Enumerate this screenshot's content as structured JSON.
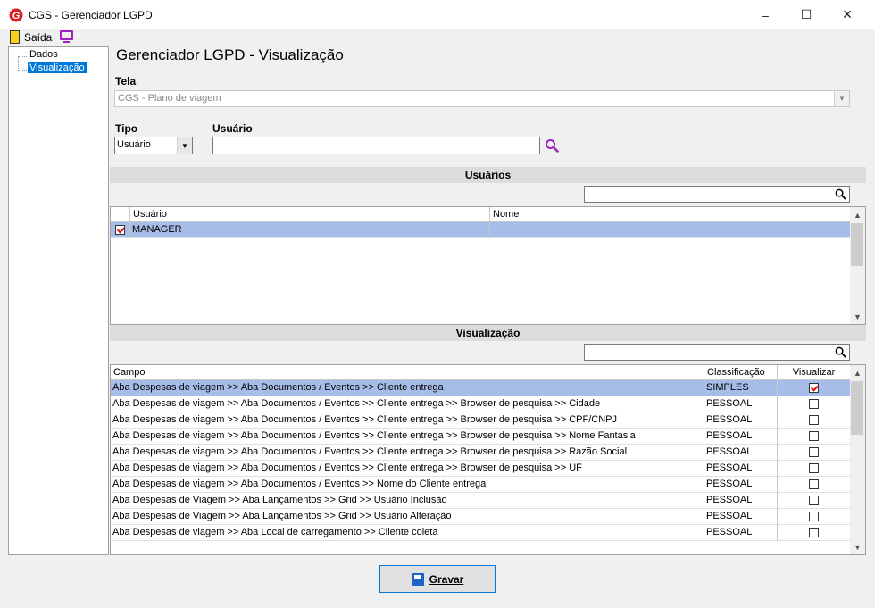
{
  "window": {
    "title": "CGS - Gerenciador LGPD",
    "minimize": "–",
    "maximize": "☐",
    "close": "✕"
  },
  "menu": {
    "exit_label": "Saída"
  },
  "tree": {
    "items": [
      "Dados",
      "Visualização"
    ],
    "selected": "Visualização"
  },
  "heading": "Gerenciador LGPD - Visualização",
  "tela": {
    "label": "Tela",
    "value": "CGS - Plano de viagem"
  },
  "tipo": {
    "label": "Tipo",
    "value": "Usuário"
  },
  "usuario": {
    "label": "Usuário",
    "value": ""
  },
  "usuarios_section": {
    "title": "Usuários",
    "search_value": "",
    "columns": [
      "Usuário",
      "Nome"
    ],
    "rows": [
      {
        "checked": true,
        "usuario": "MANAGER",
        "nome": ""
      }
    ]
  },
  "visualizacao_section": {
    "title": "Visualização",
    "search_value": "",
    "columns": [
      "Campo",
      "Classificação",
      "Visualizar"
    ],
    "rows": [
      {
        "campo": "Aba Despesas de viagem >> Aba Documentos  / Eventos >> Cliente entrega",
        "classificacao": "SIMPLES",
        "visualizar": true
      },
      {
        "campo": "Aba Despesas de viagem >> Aba Documentos  / Eventos >> Cliente entrega >> Browser de pesquisa >> Cidade",
        "classificacao": "PESSOAL",
        "visualizar": false
      },
      {
        "campo": "Aba Despesas de viagem >> Aba Documentos  / Eventos >> Cliente entrega >> Browser de pesquisa >> CPF/CNPJ",
        "classificacao": "PESSOAL",
        "visualizar": false
      },
      {
        "campo": "Aba Despesas de viagem >> Aba Documentos  / Eventos >> Cliente entrega >> Browser de pesquisa >> Nome Fantasia",
        "classificacao": "PESSOAL",
        "visualizar": false
      },
      {
        "campo": "Aba Despesas de viagem >> Aba Documentos  / Eventos >> Cliente entrega >> Browser de pesquisa >> Razão Social",
        "classificacao": "PESSOAL",
        "visualizar": false
      },
      {
        "campo": "Aba Despesas de viagem >> Aba Documentos  / Eventos >> Cliente entrega >> Browser de pesquisa >> UF",
        "classificacao": "PESSOAL",
        "visualizar": false
      },
      {
        "campo": "Aba Despesas de viagem >> Aba Documentos  / Eventos >> Nome do Cliente entrega",
        "classificacao": "PESSOAL",
        "visualizar": false
      },
      {
        "campo": "Aba Despesas de Viagem >> Aba Lançamentos >>  Grid >> Usuário Inclusão",
        "classificacao": "PESSOAL",
        "visualizar": false
      },
      {
        "campo": "Aba Despesas de Viagem >> Aba Lançamentos >> Grid >> Usuário Alteração",
        "classificacao": "PESSOAL",
        "visualizar": false
      },
      {
        "campo": "Aba Despesas de viagem >> Aba Local de carregamento >> Cliente coleta",
        "classificacao": "PESSOAL",
        "visualizar": false
      }
    ]
  },
  "save_button": {
    "label": "Gravar"
  },
  "colors": {
    "selection": "#a7bde9",
    "accent": "#0078d7",
    "icon_purple": "#a020c0"
  },
  "icons": [
    "app-logo-icon",
    "exit-door-icon",
    "monitor-icon",
    "magnifier-icon",
    "search-icon",
    "floppy-disk-icon",
    "checkbox-icon"
  ]
}
